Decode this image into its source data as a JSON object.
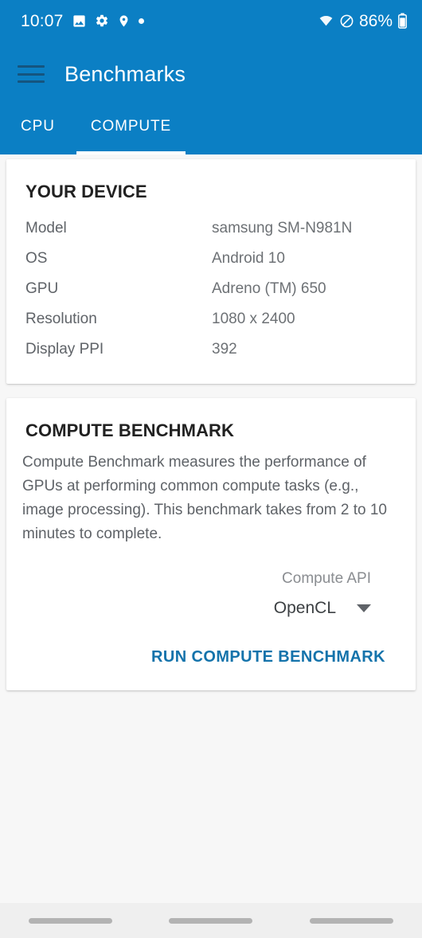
{
  "status_bar": {
    "time": "10:07",
    "left_icons": [
      "image-icon",
      "gear-icon",
      "location-pin-icon",
      "dot-icon"
    ],
    "battery_percent": "86%",
    "right_icons": [
      "wifi-icon",
      "do-not-disturb-icon",
      "battery-icon"
    ]
  },
  "app_bar": {
    "menu_icon": "hamburger-menu-icon",
    "title": "Benchmarks"
  },
  "tabs": [
    {
      "label": "CPU",
      "active": false
    },
    {
      "label": "COMPUTE",
      "active": true
    }
  ],
  "device_card": {
    "title": "YOUR DEVICE",
    "rows": [
      {
        "label": "Model",
        "value": "samsung SM-N981N"
      },
      {
        "label": "OS",
        "value": "Android 10"
      },
      {
        "label": "GPU",
        "value": "Adreno (TM) 650"
      },
      {
        "label": "Resolution",
        "value": "1080 x 2400"
      },
      {
        "label": "Display PPI",
        "value": "392"
      }
    ]
  },
  "benchmark_card": {
    "title": "COMPUTE BENCHMARK",
    "description": "Compute Benchmark measures the performance of GPUs at performing common compute tasks (e.g., image processing). This benchmark takes from 2 to 10 minutes to complete.",
    "api_label": "Compute API",
    "api_value": "OpenCL",
    "api_caret_icon": "chevron-down-icon",
    "run_button": "RUN COMPUTE BENCHMARK"
  },
  "nav_bar": {
    "items": [
      "recents-pill",
      "home-pill",
      "back-pill"
    ]
  },
  "colors": {
    "primary_blue": "#0b7fc4",
    "accent_link": "#1473ab",
    "background": "#f7f7f7",
    "card": "#ffffff",
    "text_primary": "#212121",
    "text_secondary": "#5f6368"
  }
}
